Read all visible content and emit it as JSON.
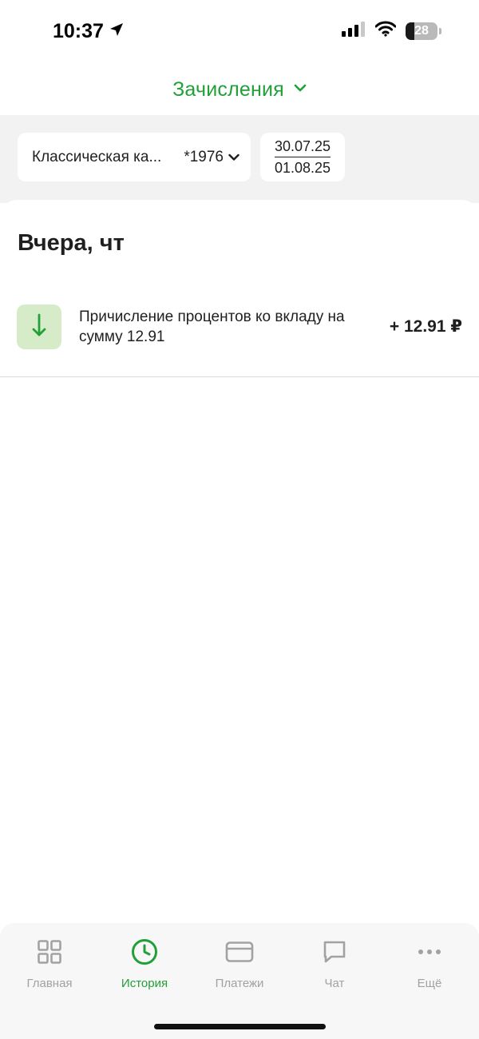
{
  "status_bar": {
    "time": "10:37",
    "battery": "28",
    "battery_level_percent": 28,
    "icons": [
      "location-arrow-icon",
      "cellular-signal-icon",
      "wifi-icon",
      "battery-icon"
    ]
  },
  "header": {
    "title": "Зачисления",
    "icon": "chevron-down-icon"
  },
  "filters": {
    "account_name": "Классическая ка...",
    "account_number": "*1976",
    "date_from": "30.07.25",
    "date_to": "01.08.25"
  },
  "history": {
    "day_heading": "Вчера, чт",
    "transactions": [
      {
        "icon": "arrow-down-icon",
        "description": "Причисление процентов ко вкладу на сумму 12.91",
        "amount": "+ 12.91 ₽"
      }
    ]
  },
  "tab_bar": {
    "tabs": [
      {
        "label": "Главная",
        "icon": "grid-icon",
        "active": false
      },
      {
        "label": "История",
        "icon": "clock-icon",
        "active": true
      },
      {
        "label": "Платежи",
        "icon": "card-icon",
        "active": false
      },
      {
        "label": "Чат",
        "icon": "chat-bubble-icon",
        "active": false
      },
      {
        "label": "Ещё",
        "icon": "more-dots-icon",
        "active": false
      }
    ]
  },
  "colors": {
    "accent": "#21a038",
    "inactive": "#a2a2a2",
    "icon_bg": "#d6ecc9"
  }
}
